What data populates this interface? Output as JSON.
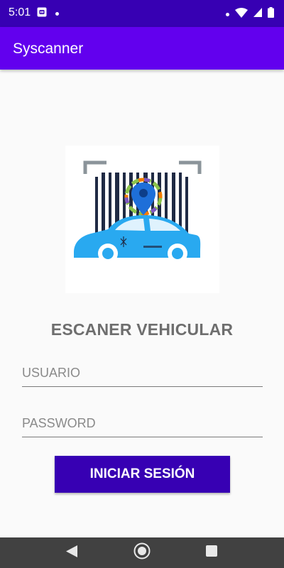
{
  "status_bar": {
    "time": "5:01",
    "icons": [
      "notification-app-icon",
      "dot-icon",
      "dot-icon",
      "wifi-icon",
      "signal-icon",
      "battery-icon"
    ]
  },
  "app_bar": {
    "title": "Syscanner"
  },
  "logo": {
    "icon": "barcode-car-logo"
  },
  "main": {
    "heading": "ESCANER VEHICULAR",
    "username_placeholder": "USUARIO",
    "username_value": "",
    "password_placeholder": "PASSWORD",
    "password_value": "",
    "login_label": "INICIAR SESIÓN"
  },
  "nav_bar": {
    "buttons": [
      "back-icon",
      "home-icon",
      "recents-icon"
    ]
  },
  "colors": {
    "status_bar": "#3700b3",
    "app_bar": "#6200ee",
    "button": "#3700b3",
    "car": "#29a9f0",
    "nav_bar": "#414141"
  }
}
